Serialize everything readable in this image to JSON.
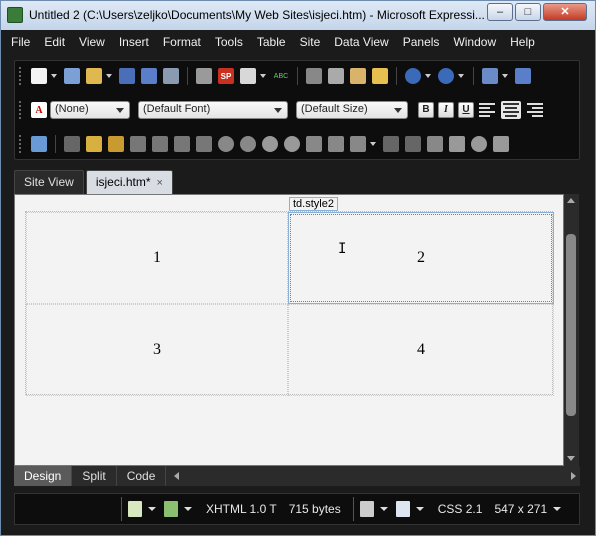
{
  "window": {
    "title": "Untitled 2 (C:\\Users\\zeljko\\Documents\\My Web Sites\\isjeci.htm) - Microsoft Expressi...",
    "min_glyph": "–",
    "max_glyph": "□",
    "close_glyph": "✕"
  },
  "menu": [
    "File",
    "Edit",
    "View",
    "Insert",
    "Format",
    "Tools",
    "Table",
    "Site",
    "Data View",
    "Panels",
    "Window",
    "Help"
  ],
  "toolbar": {
    "style_combo": "(None)",
    "font_combo": "(Default Font)",
    "size_combo": "(Default Size)",
    "bold": "B",
    "italic": "I",
    "underline": "U",
    "style_icon": "A",
    "sp_icon": "SP",
    "spell_text": "ABC"
  },
  "tabs": [
    {
      "label": "Site View"
    },
    {
      "label": "isjeci.htm*",
      "close": "×"
    }
  ],
  "editor": {
    "selected_tag": "td.style2",
    "cells": [
      "1",
      "2",
      "3",
      "4"
    ],
    "cursor": "I"
  },
  "view_buttons": [
    "Design",
    "Split",
    "Code"
  ],
  "status": {
    "doctype": "XHTML 1.0 T",
    "size": "715 bytes",
    "css": "CSS 2.1",
    "dimensions": "547 x 271"
  },
  "colors": {
    "chrome_dark": "#1b1b1b",
    "toolbar_bg": "#0d0d0d",
    "editor_bg": "#f3f3f3",
    "selection": "#8ab0d8"
  }
}
